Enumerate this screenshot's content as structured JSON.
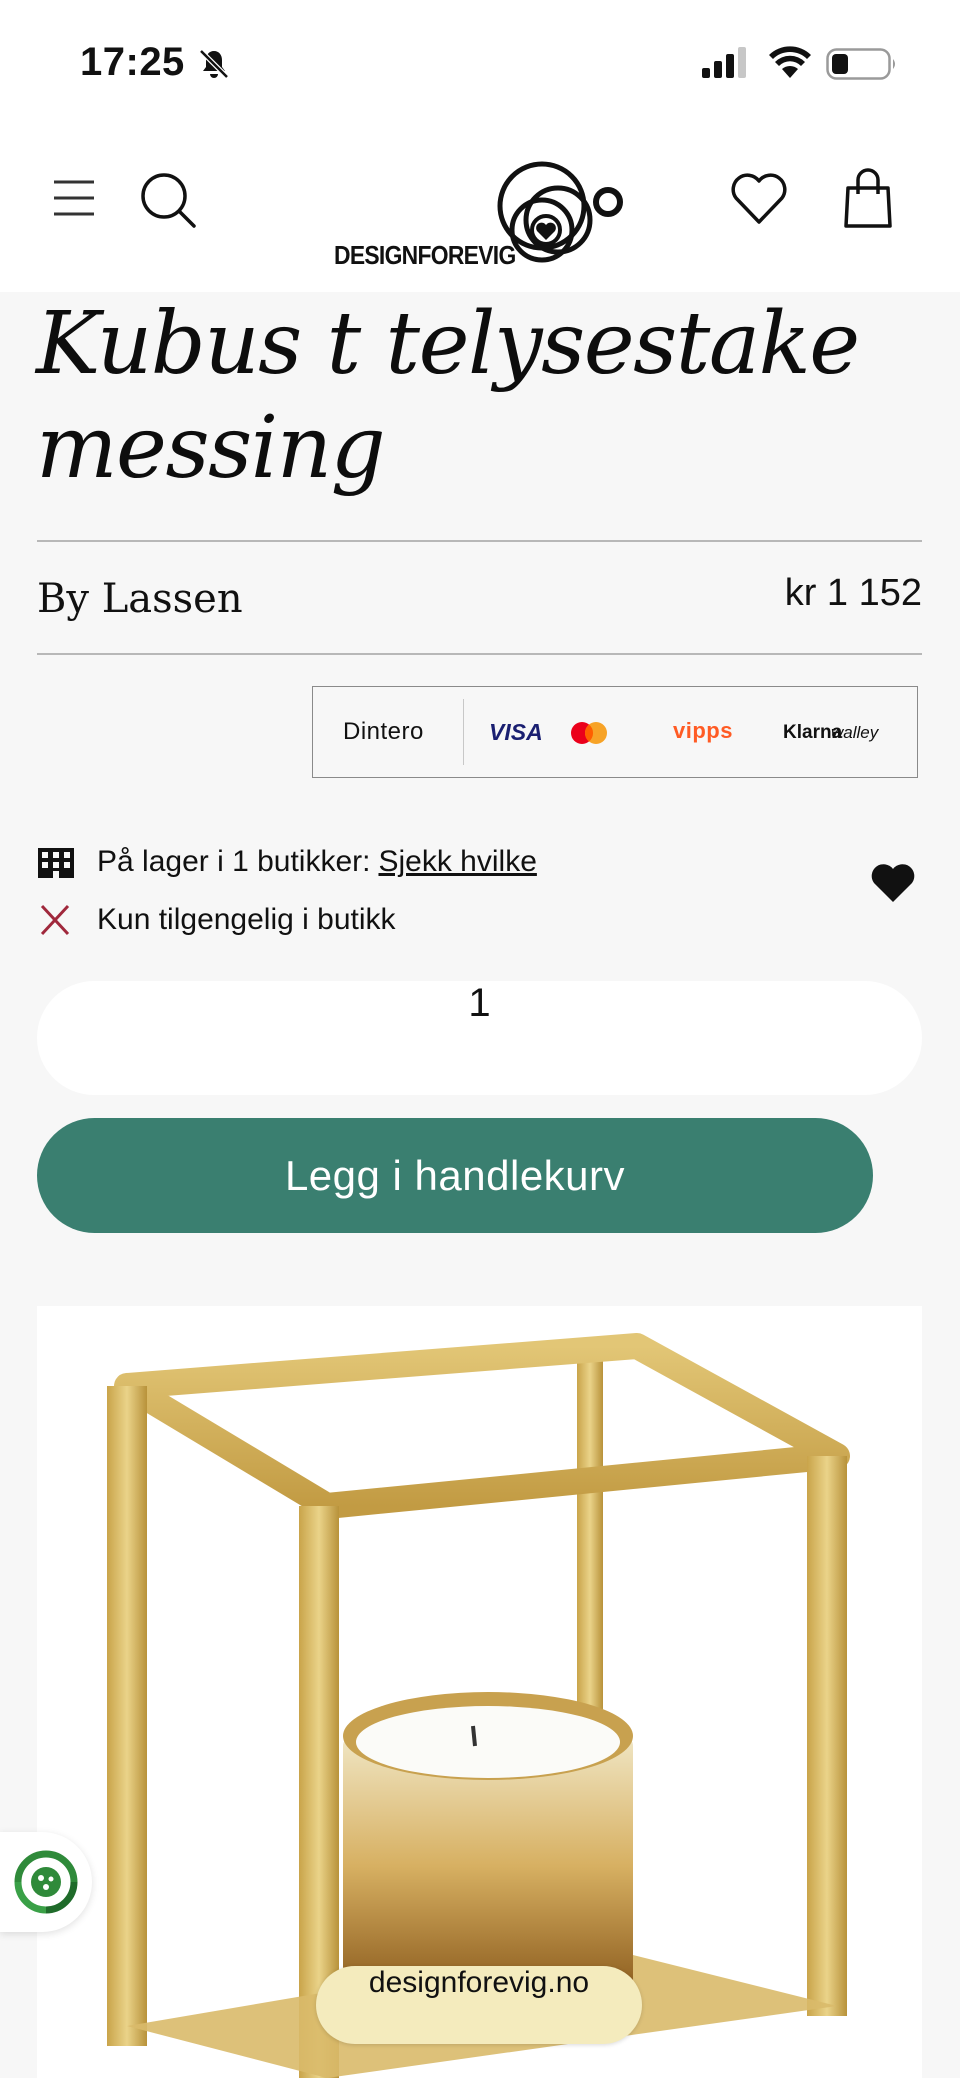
{
  "status_bar": {
    "time": "17:25",
    "icons": [
      "bell-off-icon",
      "signal-icon",
      "wifi-icon",
      "battery-icon"
    ]
  },
  "header": {
    "logo_text": "DESIGNFOREVIG",
    "icons": [
      "menu-icon",
      "search-icon",
      "heart-icon",
      "shopping-bag-icon"
    ]
  },
  "product": {
    "title_line1": "Kubus t telysestake",
    "title_line2": "messing",
    "brand": "By Lassen",
    "price": "kr 1 152"
  },
  "payment": {
    "providers": [
      "Dintero",
      "VISA",
      "vipps",
      "Klarna",
      "walley"
    ]
  },
  "stock": {
    "in_stock_text": "På lager i 1 butikker:",
    "in_stock_link": "Sjekk hvilke",
    "store_only_text": "Kun tilgengelig i butikk"
  },
  "quantity": {
    "value": "1"
  },
  "cart": {
    "add_label": "Legg i handlekurv"
  },
  "browser": {
    "url": "designforevig.no"
  },
  "colors": {
    "accent": "#3a7f70",
    "background": "#f7f7f7",
    "url_pill": "#f4ebbd",
    "cross": "#a0283c"
  }
}
